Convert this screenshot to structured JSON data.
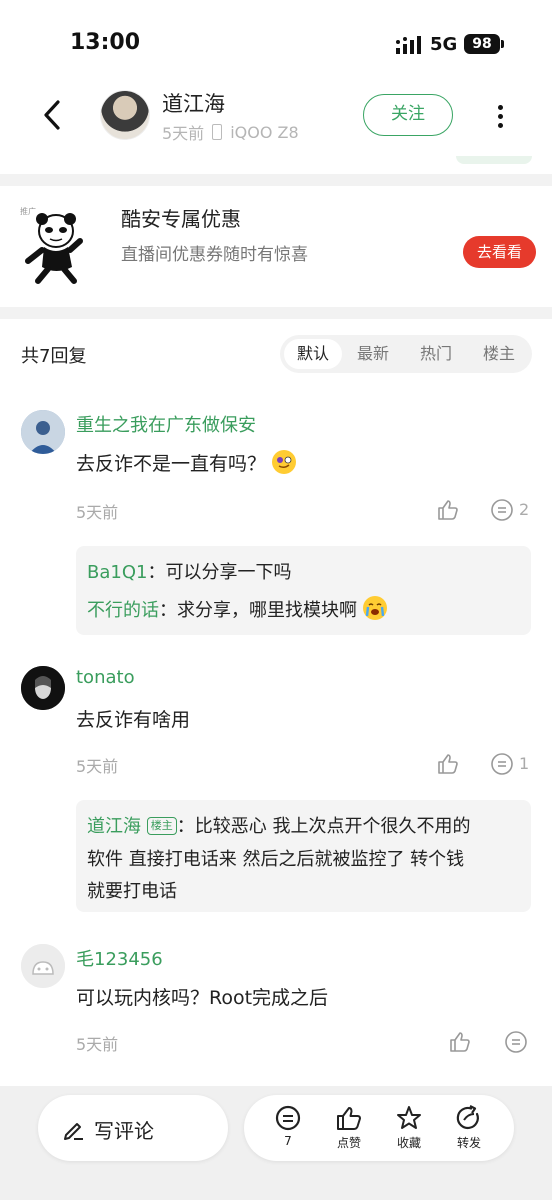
{
  "status_bar": {
    "time": "13:00",
    "network": "5G",
    "battery": "98"
  },
  "header": {
    "author": "道江海",
    "time_ago": "5天前",
    "device": "iQOO Z8",
    "follow_label": "关注"
  },
  "ad": {
    "tag": "推广",
    "title": "酷安专属优惠",
    "subtitle": "直播间优惠券随时有惊喜",
    "button": "去看看"
  },
  "replies": {
    "count_label": "共7回复",
    "sort_tabs": [
      "默认",
      "最新",
      "热门",
      "楼主"
    ],
    "active_tab": "默认"
  },
  "comments": [
    {
      "name": "重生之我在广东做保安",
      "text": "去反诈不是一直有吗？",
      "time": "5天前",
      "reply_count": "2",
      "sub_replies": [
        {
          "name": "Ba1Q1",
          "text": "：可以分享一下吗"
        },
        {
          "name": "不行的话",
          "text": "：求分享，哪里找模块啊"
        }
      ]
    },
    {
      "name": "tonato",
      "text": "去反诈有啥用",
      "time": "5天前",
      "reply_count": "1",
      "sub_replies": [
        {
          "name": "道江海",
          "badge": "楼主",
          "text_line1": "：比较恶心 我上次点开个很久不用的",
          "text_line2": "软件 直接打电话来 然后之后就被监控了 转个钱",
          "text_line3": "就要打电话"
        }
      ]
    },
    {
      "name": "毛123456",
      "text": "可以玩内核吗？Root完成之后",
      "time": "5天前"
    }
  ],
  "bottom_bar": {
    "write_label": "写评论",
    "comment_count": "7",
    "like_label": "点赞",
    "favorite_label": "收藏",
    "share_label": "转发"
  }
}
